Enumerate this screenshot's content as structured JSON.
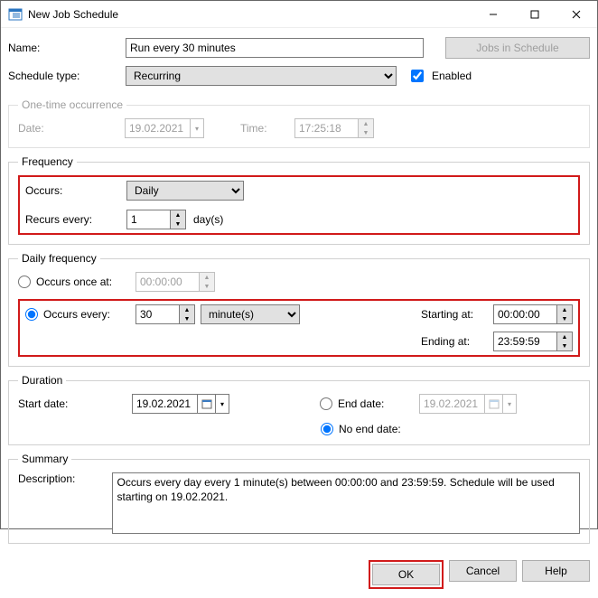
{
  "window": {
    "title": "New Job Schedule"
  },
  "labels": {
    "name": "Name:",
    "schedule_type": "Schedule type:",
    "enabled": "Enabled",
    "jobs_btn": "Jobs in Schedule",
    "onetime_legend": "One-time occurrence",
    "date": "Date:",
    "time": "Time:",
    "frequency_legend": "Frequency",
    "occurs": "Occurs:",
    "recurs_every": "Recurs every:",
    "days_unit": "day(s)",
    "daily_freq_legend": "Daily frequency",
    "occurs_once_at": "Occurs once at:",
    "occurs_every": "Occurs every:",
    "starting_at": "Starting at:",
    "ending_at": "Ending at:",
    "duration_legend": "Duration",
    "start_date": "Start date:",
    "end_date": "End date:",
    "no_end_date": "No end date:",
    "summary_legend": "Summary",
    "description": "Description:",
    "ok": "OK",
    "cancel": "Cancel",
    "help": "Help"
  },
  "values": {
    "name": "Run every 30 minutes",
    "schedule_type": "Recurring",
    "enabled": true,
    "onetime_date": "19.02.2021",
    "onetime_time": "17:25:18",
    "occurs": "Daily",
    "recurs_every": "1",
    "occurs_once_time": "00:00:00",
    "occurs_every_value": "30",
    "occurs_every_unit": "minute(s)",
    "starting_at": "00:00:00",
    "ending_at": "23:59:59",
    "start_date": "19.02.2021",
    "end_date": "19.02.2021",
    "daily_mode": "every",
    "duration_mode": "no_end",
    "description": "Occurs every day every 1 minute(s) between 00:00:00 and 23:59:59. Schedule will be used starting on 19.02.2021."
  },
  "options": {
    "schedule_type": [
      "Recurring"
    ],
    "occurs": [
      "Daily"
    ],
    "occurs_every_unit": [
      "minute(s)"
    ]
  }
}
